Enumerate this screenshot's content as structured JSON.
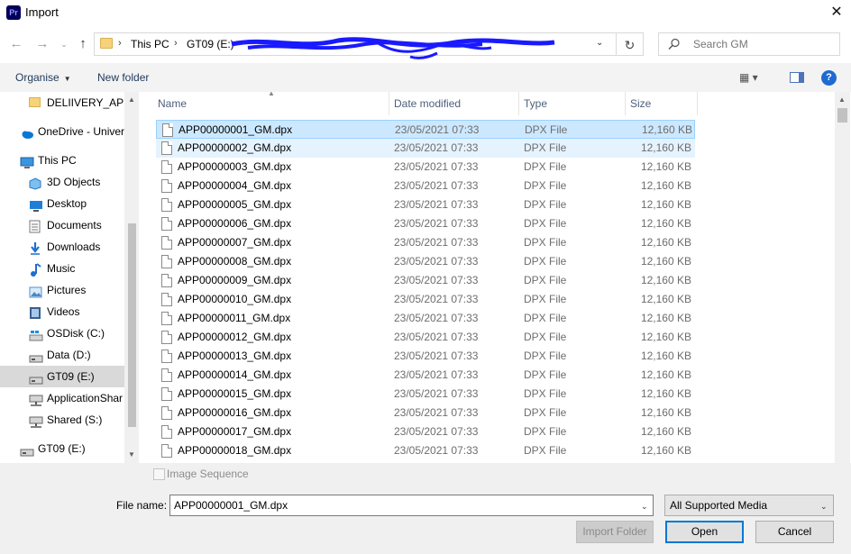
{
  "window": {
    "app_icon_text": "Pr",
    "title": "Import",
    "close_glyph": "✕"
  },
  "address_bar": {
    "breadcrumbs": [
      "This PC",
      "GT09 (E:)"
    ],
    "redacted": true,
    "refresh_glyph": "↻",
    "dropdown_glyph": "⌄"
  },
  "search": {
    "placeholder": "Search GM"
  },
  "toolbar": {
    "organise_label": "Organise",
    "new_folder_label": "New folder",
    "view_glyph": "▦ ▾",
    "help_glyph": "?"
  },
  "nav_pane": {
    "items": [
      {
        "label": "DELIIVERY_APP",
        "icon": "folder-icon",
        "indent": 1,
        "selected": false
      },
      {
        "label": "OneDrive - Univer",
        "icon": "cloud-icon",
        "indent": 0,
        "selected": false
      },
      {
        "label": "This PC",
        "icon": "computer-icon",
        "indent": 0,
        "selected": false
      },
      {
        "label": "3D Objects",
        "icon": "cube-icon",
        "indent": 1,
        "selected": false
      },
      {
        "label": "Desktop",
        "icon": "desktop-icon",
        "indent": 1,
        "selected": false
      },
      {
        "label": "Documents",
        "icon": "document-icon",
        "indent": 1,
        "selected": false
      },
      {
        "label": "Downloads",
        "icon": "download-icon",
        "indent": 1,
        "selected": false
      },
      {
        "label": "Music",
        "icon": "music-icon",
        "indent": 1,
        "selected": false
      },
      {
        "label": "Pictures",
        "icon": "pictures-icon",
        "indent": 1,
        "selected": false
      },
      {
        "label": "Videos",
        "icon": "videos-icon",
        "indent": 1,
        "selected": false
      },
      {
        "label": "OSDisk (C:)",
        "icon": "windows-drive-icon",
        "indent": 1,
        "selected": false
      },
      {
        "label": "Data (D:)",
        "icon": "drive-icon",
        "indent": 1,
        "selected": false
      },
      {
        "label": "GT09 (E:)",
        "icon": "drive-icon",
        "indent": 1,
        "selected": true
      },
      {
        "label": "ApplicationShar",
        "icon": "network-drive-icon",
        "indent": 1,
        "selected": false
      },
      {
        "label": "Shared (S:)",
        "icon": "network-drive-icon",
        "indent": 1,
        "selected": false
      },
      {
        "label": "GT09 (E:)",
        "icon": "drive-icon",
        "indent": 0,
        "selected": false
      }
    ]
  },
  "file_list": {
    "columns": [
      "Name",
      "Date modified",
      "Type",
      "Size"
    ],
    "rows": [
      {
        "name": "APP00000001_GM.dpx",
        "date": "23/05/2021 07:33",
        "type": "DPX File",
        "size": "12,160 KB",
        "state": "selected"
      },
      {
        "name": "APP00000002_GM.dpx",
        "date": "23/05/2021 07:33",
        "type": "DPX File",
        "size": "12,160 KB",
        "state": "hover"
      },
      {
        "name": "APP00000003_GM.dpx",
        "date": "23/05/2021 07:33",
        "type": "DPX File",
        "size": "12,160 KB",
        "state": ""
      },
      {
        "name": "APP00000004_GM.dpx",
        "date": "23/05/2021 07:33",
        "type": "DPX File",
        "size": "12,160 KB",
        "state": ""
      },
      {
        "name": "APP00000005_GM.dpx",
        "date": "23/05/2021 07:33",
        "type": "DPX File",
        "size": "12,160 KB",
        "state": ""
      },
      {
        "name": "APP00000006_GM.dpx",
        "date": "23/05/2021 07:33",
        "type": "DPX File",
        "size": "12,160 KB",
        "state": ""
      },
      {
        "name": "APP00000007_GM.dpx",
        "date": "23/05/2021 07:33",
        "type": "DPX File",
        "size": "12,160 KB",
        "state": ""
      },
      {
        "name": "APP00000008_GM.dpx",
        "date": "23/05/2021 07:33",
        "type": "DPX File",
        "size": "12,160 KB",
        "state": ""
      },
      {
        "name": "APP00000009_GM.dpx",
        "date": "23/05/2021 07:33",
        "type": "DPX File",
        "size": "12,160 KB",
        "state": ""
      },
      {
        "name": "APP00000010_GM.dpx",
        "date": "23/05/2021 07:33",
        "type": "DPX File",
        "size": "12,160 KB",
        "state": ""
      },
      {
        "name": "APP00000011_GM.dpx",
        "date": "23/05/2021 07:33",
        "type": "DPX File",
        "size": "12,160 KB",
        "state": ""
      },
      {
        "name": "APP00000012_GM.dpx",
        "date": "23/05/2021 07:33",
        "type": "DPX File",
        "size": "12,160 KB",
        "state": ""
      },
      {
        "name": "APP00000013_GM.dpx",
        "date": "23/05/2021 07:33",
        "type": "DPX File",
        "size": "12,160 KB",
        "state": ""
      },
      {
        "name": "APP00000014_GM.dpx",
        "date": "23/05/2021 07:33",
        "type": "DPX File",
        "size": "12,160 KB",
        "state": ""
      },
      {
        "name": "APP00000015_GM.dpx",
        "date": "23/05/2021 07:33",
        "type": "DPX File",
        "size": "12,160 KB",
        "state": ""
      },
      {
        "name": "APP00000016_GM.dpx",
        "date": "23/05/2021 07:33",
        "type": "DPX File",
        "size": "12,160 KB",
        "state": ""
      },
      {
        "name": "APP00000017_GM.dpx",
        "date": "23/05/2021 07:33",
        "type": "DPX File",
        "size": "12,160 KB",
        "state": ""
      },
      {
        "name": "APP00000018_GM.dpx",
        "date": "23/05/2021 07:33",
        "type": "DPX File",
        "size": "12,160 KB",
        "state": ""
      }
    ]
  },
  "bottom": {
    "image_sequence_label": "Image Sequence",
    "image_sequence_checked": false,
    "file_name_label": "File name:",
    "file_name_value": "APP00000001_GM.dpx",
    "filter_value": "All Supported Media",
    "import_folder_label": "Import Folder",
    "open_label": "Open",
    "cancel_label": "Cancel"
  },
  "colors": {
    "selected_row": "#cce8ff",
    "hover_row": "#e5f3ff",
    "accent": "#0078d7",
    "redaction_ink": "#1a1aff"
  }
}
